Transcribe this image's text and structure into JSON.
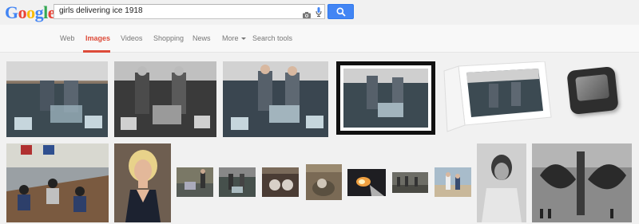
{
  "logo": {
    "letters": [
      "G",
      "o",
      "o",
      "g",
      "l",
      "e"
    ],
    "colors": [
      "#4285f4",
      "#ea4335",
      "#fbbc05",
      "#4285f4",
      "#34a853",
      "#ea4335"
    ]
  },
  "search": {
    "query": "girls delivering ice 1918"
  },
  "icons": {
    "camera": "camera-icon",
    "mic": "microphone-icon",
    "search": "magnifier-icon"
  },
  "nav": {
    "items": [
      {
        "label": "Web"
      },
      {
        "label": "Images"
      },
      {
        "label": "Videos"
      },
      {
        "label": "Shopping"
      },
      {
        "label": "News"
      },
      {
        "label": "More"
      },
      {
        "label": "Search tools"
      }
    ],
    "active_index": 1
  },
  "colors": {
    "accent": "#dd4b39",
    "search_button": "#4285f4"
  }
}
